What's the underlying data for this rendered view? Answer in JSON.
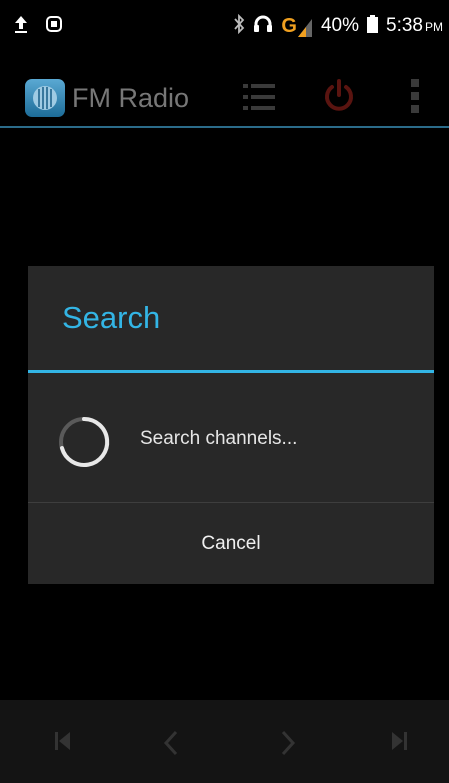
{
  "status_bar": {
    "battery_percent": "40%",
    "time": "5:38",
    "time_suffix": "PM",
    "network": "G",
    "icons": [
      "upload-icon",
      "sync-icon",
      "bluetooth-icon",
      "headphones-icon",
      "signal-icon",
      "battery-icon"
    ]
  },
  "action_bar": {
    "title": "FM Radio",
    "icons": [
      "fm-radio-app-icon",
      "channel-list-icon",
      "power-icon",
      "overflow-menu-icon"
    ],
    "power_color": "#cc2a1f"
  },
  "dialog": {
    "title": "Search",
    "message": "Search channels...",
    "cancel_label": "Cancel",
    "accent_color": "#33b5e5"
  },
  "bottom_bar": {
    "icons": [
      "skip-previous-icon",
      "seek-back-icon",
      "seek-forward-icon",
      "skip-next-icon"
    ]
  }
}
